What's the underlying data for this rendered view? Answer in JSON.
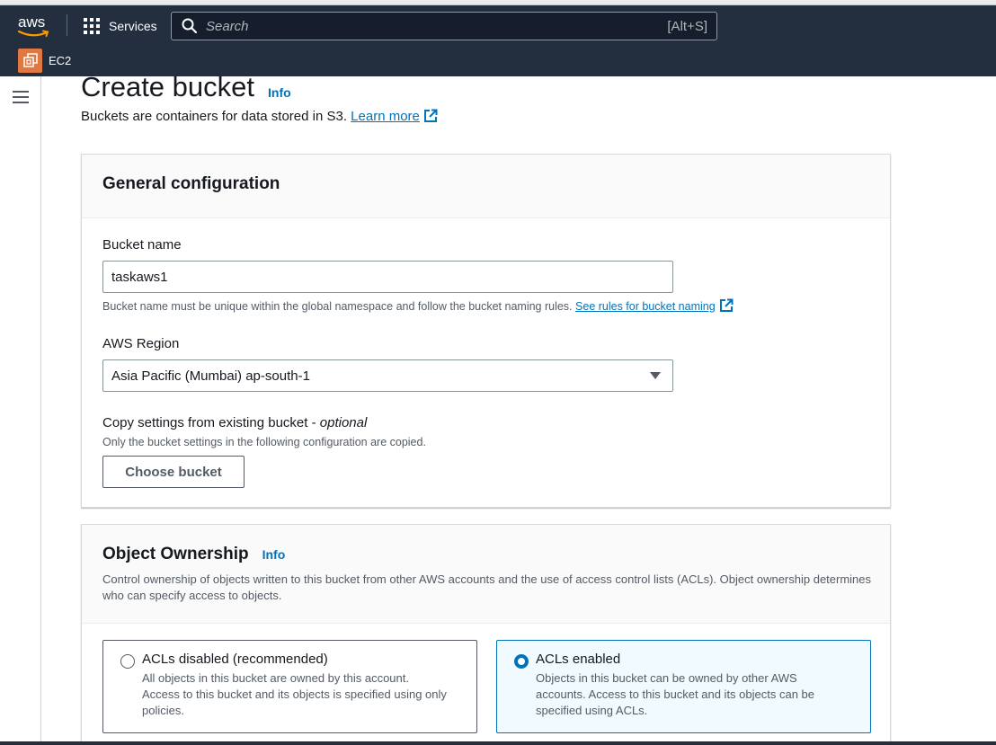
{
  "nav": {
    "logo_text": "aws",
    "services_label": "Services",
    "search_placeholder": "Search",
    "search_shortcut": "[Alt+S]",
    "favorite_service": "EC2"
  },
  "page": {
    "title": "Create bucket",
    "title_info": "Info",
    "subtitle": "Buckets are containers for data stored in S3.",
    "learn_more": "Learn more"
  },
  "general": {
    "heading": "General configuration",
    "bucket_name_label": "Bucket name",
    "bucket_name_value": "taskaws1",
    "bucket_name_hint": "Bucket name must be unique within the global namespace and follow the bucket naming rules.",
    "bucket_name_rules_link": "See rules for bucket naming",
    "region_label": "AWS Region",
    "region_value": "Asia Pacific (Mumbai) ap-south-1",
    "copy_label": "Copy settings from existing bucket - ",
    "copy_optional": "optional",
    "copy_hint": "Only the bucket settings in the following configuration are copied.",
    "choose_bucket": "Choose bucket"
  },
  "ownership": {
    "heading": "Object Ownership",
    "info": "Info",
    "description": "Control ownership of objects written to this bucket from other AWS accounts and the use of access control lists (ACLs). Object ownership determines who can specify access to objects.",
    "options": [
      {
        "label": "ACLs disabled (recommended)",
        "description": "All objects in this bucket are owned by this account. Access to this bucket and its objects is specified using only policies.",
        "selected": false
      },
      {
        "label": "ACLs enabled",
        "description": "Objects in this bucket can be owned by other AWS accounts. Access to this bucket and its objects can be specified using ACLs.",
        "selected": true
      }
    ]
  },
  "colors": {
    "nav_bg": "#232f3e",
    "link": "#0073bb",
    "ec2_orange": "#e07941"
  }
}
